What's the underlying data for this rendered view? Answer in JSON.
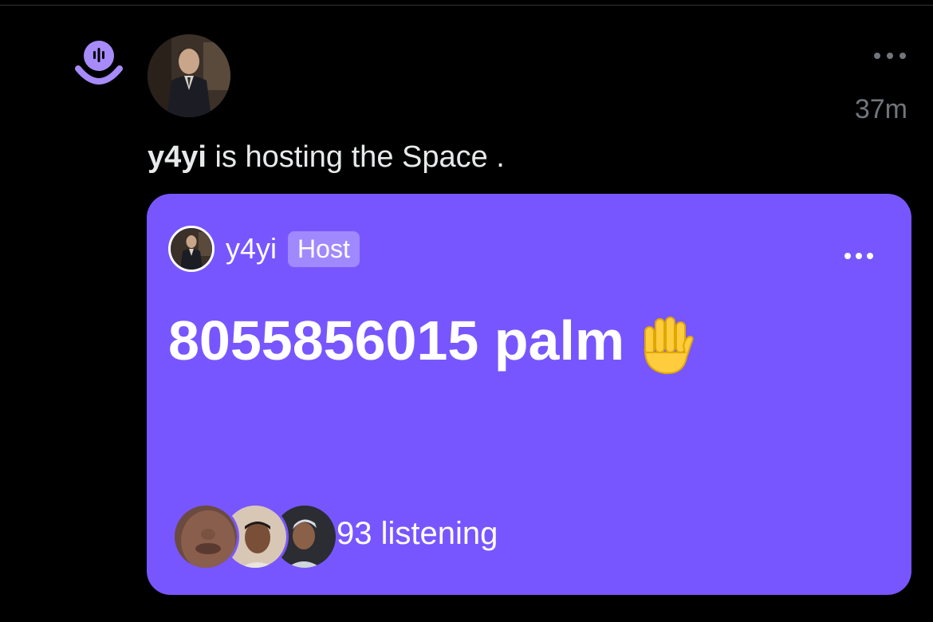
{
  "post": {
    "timestamp": "37m",
    "context": {
      "user": "y4yi",
      "text": "is hosting the Space .",
      "separator": " "
    }
  },
  "space_card": {
    "host_name": "y4yi",
    "host_badge": "Host",
    "title": "8055856015 palm",
    "title_emoji_icon": "raised-hand-icon",
    "listening_text": "93 listening"
  },
  "colors": {
    "background": "#000000",
    "card": "#7856ff",
    "spaces_icon": "#a78bfa",
    "muted_text": "#71767b"
  }
}
